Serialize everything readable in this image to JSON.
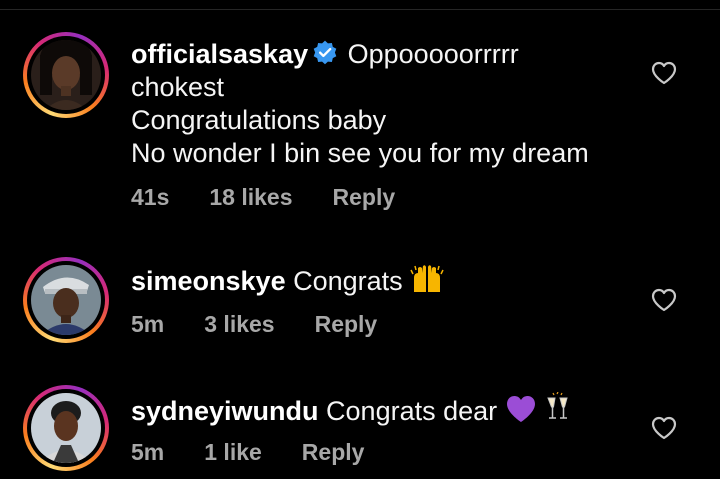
{
  "comments": [
    {
      "username": "officialsaskay",
      "verified": true,
      "text": "Oppooooorrrrr\nchokest\nCongratulations baby\nNo wonder I bin see you for my dream",
      "time": "41s",
      "likes": "18 likes",
      "reply_label": "Reply"
    },
    {
      "username": "simeonskye",
      "verified": false,
      "text": "Congrats",
      "emoji": "raising-hands",
      "time": "5m",
      "likes": "3 likes",
      "reply_label": "Reply"
    },
    {
      "username": "sydneyiwundu",
      "verified": false,
      "text": "Congrats dear",
      "emoji": "purple-heart, champagne-glasses",
      "time": "5m",
      "likes": "1 like",
      "reply_label": "Reply"
    }
  ],
  "icons": {
    "verified": "verified-badge-icon",
    "like": "heart-outline-icon"
  },
  "colors": {
    "background": "#000000",
    "text": "#f5f5f5",
    "meta": "#a8a8a8",
    "verified": "#3897f0"
  }
}
